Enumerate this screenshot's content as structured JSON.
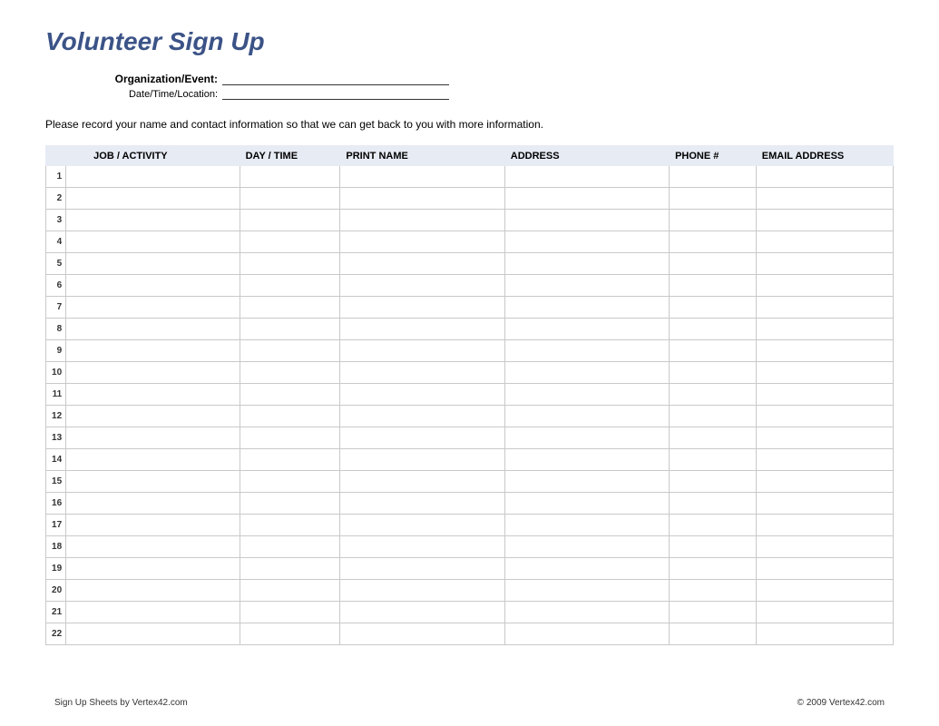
{
  "title": "Volunteer Sign Up",
  "meta": {
    "org_label": "Organization/Event:",
    "dtl_label": "Date/Time/Location:",
    "org_value": "",
    "dtl_value": ""
  },
  "instructions": "Please record your name and contact information so that we can get back to you with more information.",
  "columns": {
    "job": "JOB / ACTIVITY",
    "day": "DAY / TIME",
    "name": "PRINT NAME",
    "address": "ADDRESS",
    "phone": "PHONE #",
    "email": "EMAIL ADDRESS"
  },
  "rows": [
    {
      "n": "1",
      "job": "",
      "day": "",
      "name": "",
      "address": "",
      "phone": "",
      "email": ""
    },
    {
      "n": "2",
      "job": "",
      "day": "",
      "name": "",
      "address": "",
      "phone": "",
      "email": ""
    },
    {
      "n": "3",
      "job": "",
      "day": "",
      "name": "",
      "address": "",
      "phone": "",
      "email": ""
    },
    {
      "n": "4",
      "job": "",
      "day": "",
      "name": "",
      "address": "",
      "phone": "",
      "email": ""
    },
    {
      "n": "5",
      "job": "",
      "day": "",
      "name": "",
      "address": "",
      "phone": "",
      "email": ""
    },
    {
      "n": "6",
      "job": "",
      "day": "",
      "name": "",
      "address": "",
      "phone": "",
      "email": ""
    },
    {
      "n": "7",
      "job": "",
      "day": "",
      "name": "",
      "address": "",
      "phone": "",
      "email": ""
    },
    {
      "n": "8",
      "job": "",
      "day": "",
      "name": "",
      "address": "",
      "phone": "",
      "email": ""
    },
    {
      "n": "9",
      "job": "",
      "day": "",
      "name": "",
      "address": "",
      "phone": "",
      "email": ""
    },
    {
      "n": "10",
      "job": "",
      "day": "",
      "name": "",
      "address": "",
      "phone": "",
      "email": ""
    },
    {
      "n": "11",
      "job": "",
      "day": "",
      "name": "",
      "address": "",
      "phone": "",
      "email": ""
    },
    {
      "n": "12",
      "job": "",
      "day": "",
      "name": "",
      "address": "",
      "phone": "",
      "email": ""
    },
    {
      "n": "13",
      "job": "",
      "day": "",
      "name": "",
      "address": "",
      "phone": "",
      "email": ""
    },
    {
      "n": "14",
      "job": "",
      "day": "",
      "name": "",
      "address": "",
      "phone": "",
      "email": ""
    },
    {
      "n": "15",
      "job": "",
      "day": "",
      "name": "",
      "address": "",
      "phone": "",
      "email": ""
    },
    {
      "n": "16",
      "job": "",
      "day": "",
      "name": "",
      "address": "",
      "phone": "",
      "email": ""
    },
    {
      "n": "17",
      "job": "",
      "day": "",
      "name": "",
      "address": "",
      "phone": "",
      "email": ""
    },
    {
      "n": "18",
      "job": "",
      "day": "",
      "name": "",
      "address": "",
      "phone": "",
      "email": ""
    },
    {
      "n": "19",
      "job": "",
      "day": "",
      "name": "",
      "address": "",
      "phone": "",
      "email": ""
    },
    {
      "n": "20",
      "job": "",
      "day": "",
      "name": "",
      "address": "",
      "phone": "",
      "email": ""
    },
    {
      "n": "21",
      "job": "",
      "day": "",
      "name": "",
      "address": "",
      "phone": "",
      "email": ""
    },
    {
      "n": "22",
      "job": "",
      "day": "",
      "name": "",
      "address": "",
      "phone": "",
      "email": ""
    }
  ],
  "footer": {
    "left": "Sign Up Sheets by Vertex42.com",
    "right": "© 2009 Vertex42.com"
  }
}
